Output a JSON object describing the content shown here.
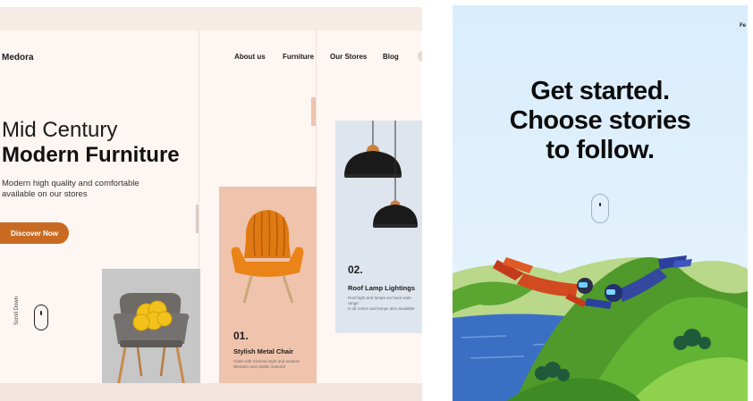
{
  "furniture_site": {
    "logo": "Medora",
    "nav": [
      "About us",
      "Furniture",
      "Our Stores",
      "Blog"
    ],
    "hero_title_light": "Mid Century",
    "hero_title_bold": "Modern Furniture",
    "hero_description_line1": "Modern high quality and comfortable",
    "hero_description_line2": "available on our stores",
    "cta_label": "Discover Now",
    "scroll_label": "Scroll Down",
    "cards": [
      {
        "number": "01.",
        "title": "Stylish Metal Chair",
        "text_line1": "Chair with minimal style and modern",
        "text_line2": "Wooden and plastic material"
      },
      {
        "number": "02.",
        "title": "Roof Lamp Lightings",
        "text_line1": "Roof light and lamps we have wide range",
        "text_line2": "in all colors and lamps also available"
      }
    ],
    "colors": {
      "accent": "#c86a22",
      "background": "#fdf6f2",
      "orange_card": "#f0c3ad",
      "blue_card": "#dfe5ee",
      "gray_card": "#c7c7c7"
    }
  },
  "stories_page": {
    "top_right_text": "Fe",
    "headline_lines": [
      "Get started.",
      "Choose stories",
      "to follow."
    ],
    "colors": {
      "sky": "#d7ecfc",
      "hills": "#4f9a2a",
      "water": "#3b6fc4"
    }
  }
}
